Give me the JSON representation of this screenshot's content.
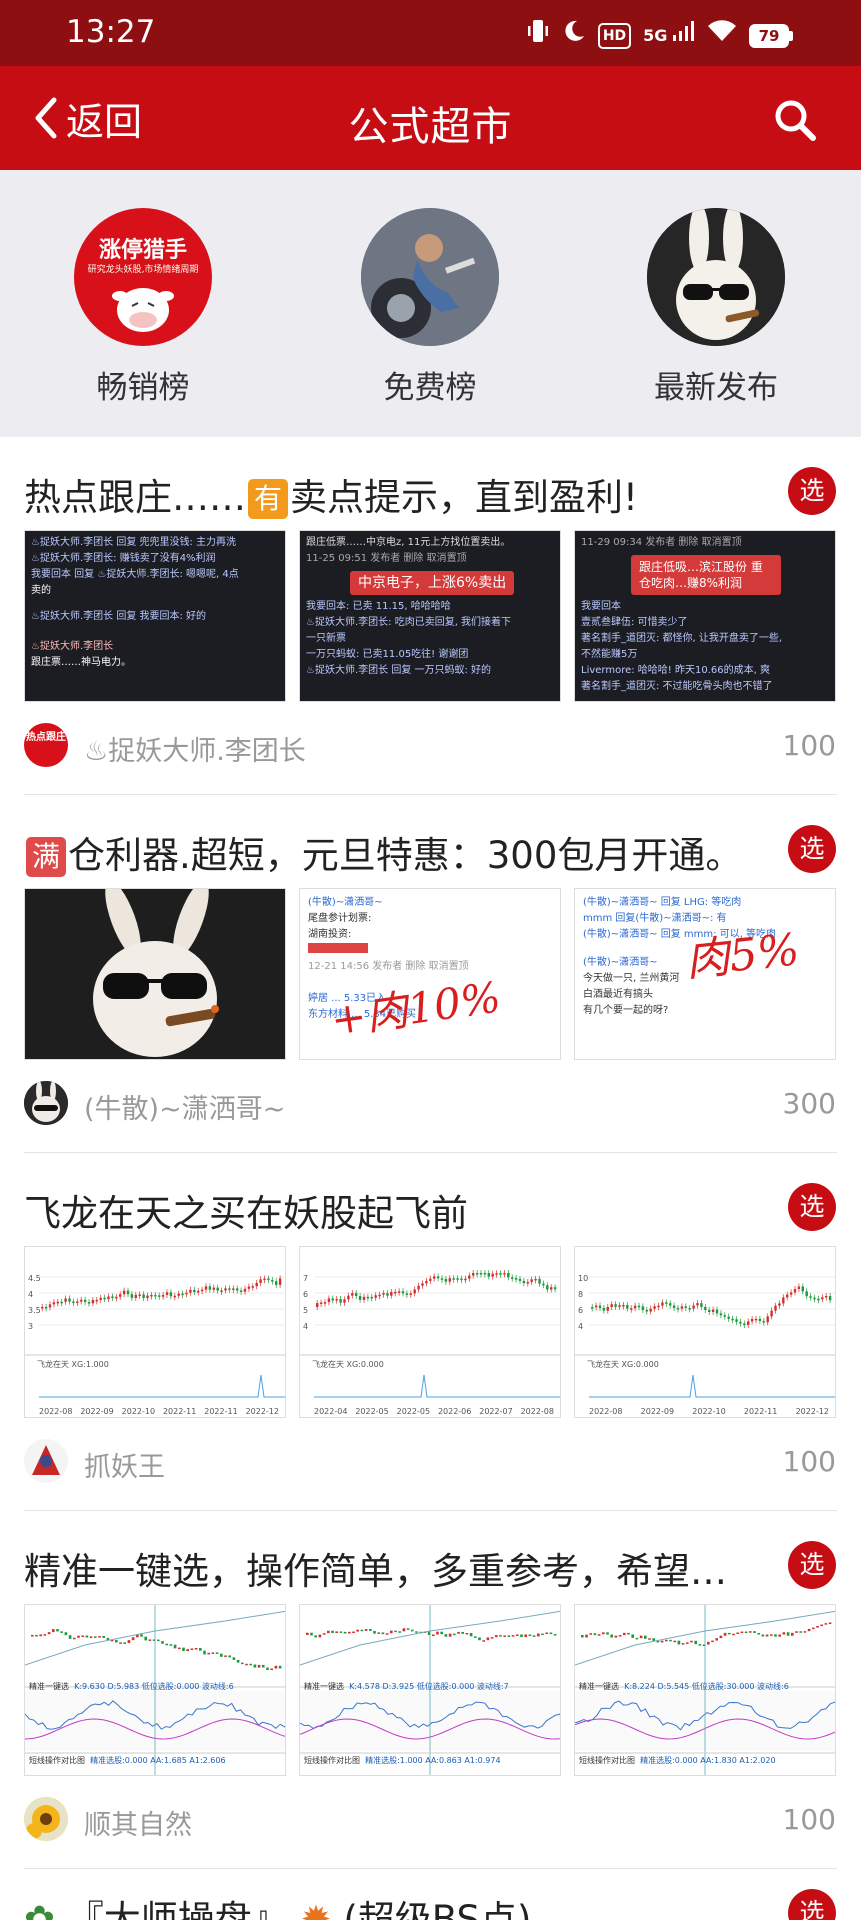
{
  "status_bar": {
    "time": "13:27",
    "hd": "HD",
    "network": "5G",
    "battery": "79"
  },
  "nav": {
    "back_label": "返回",
    "title": "公式超市"
  },
  "categories": [
    {
      "label": "畅销榜",
      "avatar_text": "涨停猎手",
      "avatar_subtext": "研究龙头妖股,市场情绪周期"
    },
    {
      "label": "免费榜"
    },
    {
      "label": "最新发布"
    }
  ],
  "select_label": "选",
  "cards": [
    {
      "title_pre": "热点跟庄……",
      "title_emoji": "有",
      "title_post": "卖点提示，直到盈利!",
      "author": "♨捉妖大师.李团长",
      "author_badge": "热点跟庄",
      "price": "100",
      "thumbs": [
        {
          "lines": [
            "♨捉妖大师.李团长 回复 兜兜里没钱: 主力再洗",
            "♨捉妖大师.李团长: 赚钱卖了没有4%利润",
            "我要回本 回复 ♨捉妖大师.李团长: 嗯嗯呢, 4点",
            "卖的",
            "♨捉妖大师.李团长 回复 我要回本: 好的",
            "♨捉妖大师.李团长",
            "跟庄票……神马电力。"
          ]
        },
        {
          "banner": "中京电子，上涨6%卖出",
          "lines": [
            "跟庄低票……中京电z, 11元上方找位置卖出。",
            "11-25 09:51 发布者  删除  取消置顶",
            "我要回本: 已卖 11.15, 哈哈哈哈",
            "♨捉妖大师.李团长: 吃肉已卖回复, 我们接着下",
            "一只新票",
            "一万只蚂蚁: 已卖11.05吃往! 谢谢团",
            "♨捉妖大师.李团长 回复 一万只蚂蚁: 好的"
          ]
        },
        {
          "banner": "跟庄低吸…滨江股份 重仓吃肉…赚8%利润",
          "lines": [
            "11-29 09:34 发布者  删除  取消置顶",
            "我要回本",
            "壹贰叁肆伍: 可惜卖少了",
            "著名割手_道团灭: 都怪你, 让我开盘卖了一些,",
            "不然能赚5万",
            "Livermore: 哈哈哈! 昨天10.66的成本, 爽",
            "著名割手_道团灭: 不过能吃骨头肉也不错了"
          ]
        }
      ]
    },
    {
      "title_pre": "",
      "title_emoji": "满",
      "title_post": "仓利器.超短，元旦特惠：300包月开通。",
      "author": "(牛散)~潇洒哥~",
      "price": "300",
      "thumbs": [
        {
          "photo": "rabbit"
        },
        {
          "lines": [
            "(牛散)~潇洒哥~",
            "尾盘参计划票:",
            "湖南投资:",
            "",
            "12-21 14:56 发布者  删除  取消置顶",
            "",
            "婷居 ... 5.33已入",
            "东方材料 ... 5.34已购买"
          ],
          "overlay": "+肉10%"
        },
        {
          "lines": [
            "(牛散)~潇洒哥~ 回复 LHG: 等吃肉",
            "mmm 回复(牛散)~潇洒哥~: 有",
            "(牛散)~潇洒哥~ 回复 mmm: 可以, 等吃肉",
            "(牛散)~潇洒哥~",
            "今天做一只, 兰州黄河",
            "白酒最近有搞头",
            "有几个要一起的呀?"
          ],
          "overlay": "肉5%"
        }
      ]
    },
    {
      "title_pre": "飞龙在天之买在妖股起飞前",
      "title_emoji": "",
      "title_post": "",
      "author": "抓妖王",
      "price": "100",
      "thumbs": [
        {
          "ylabels": [
            "4.5",
            "4",
            "3.5",
            "3"
          ],
          "xlabels": [
            "2022-08",
            "2022-09",
            "2022-10",
            "2022-11",
            "2022-11",
            "2022-12"
          ],
          "indicator": "飞龙在天  XG:1.000"
        },
        {
          "ylabels": [
            "7",
            "6",
            "5",
            "4"
          ],
          "xlabels": [
            "2022-04",
            "2022-05",
            "2022-05",
            "2022-06",
            "2022-07",
            "2022-08"
          ],
          "indicator": "飞龙在天  XG:0.000"
        },
        {
          "ylabels": [
            "10",
            "8",
            "6",
            "4"
          ],
          "xlabels": [
            "2022-08",
            "2022-09",
            "2022-10",
            "2022-11",
            "2022-12"
          ],
          "indicator": "飞龙在天  XG:0.000"
        }
      ]
    },
    {
      "title_pre": "精准一键选，操作简单，多重参考，希望…",
      "title_emoji": "",
      "title_post": "",
      "author": "顺其自然",
      "price": "100",
      "thumbs": [
        {
          "label_a": "精准一键选",
          "stats": "K:9.630  D:5.983  低位选股:0.000  波动线:6",
          "label_b": "短线操作对比图",
          "stats2": "精准选股:0.000  AA:1.685  A1:2.606"
        },
        {
          "label_a": "精准一键选",
          "stats": "K:4.578  D:3.925  低位选股:0.000  波动线:7",
          "label_b": "短线操作对比图",
          "stats2": "精准选股:1.000  AA:0.863  A1:0.974"
        },
        {
          "label_a": "精准一键选",
          "stats": "K:8.224  D:5.545  低位选股:30.000  波动线:6",
          "label_b": "短线操作对比图",
          "stats2": "精准选股:0.000  AA:1.830  A1:2.020"
        }
      ]
    },
    {
      "title_pre": "『大师操盘』",
      "title_emoji": "",
      "title_post": "(超级BS点)",
      "author": "",
      "price": ""
    }
  ]
}
